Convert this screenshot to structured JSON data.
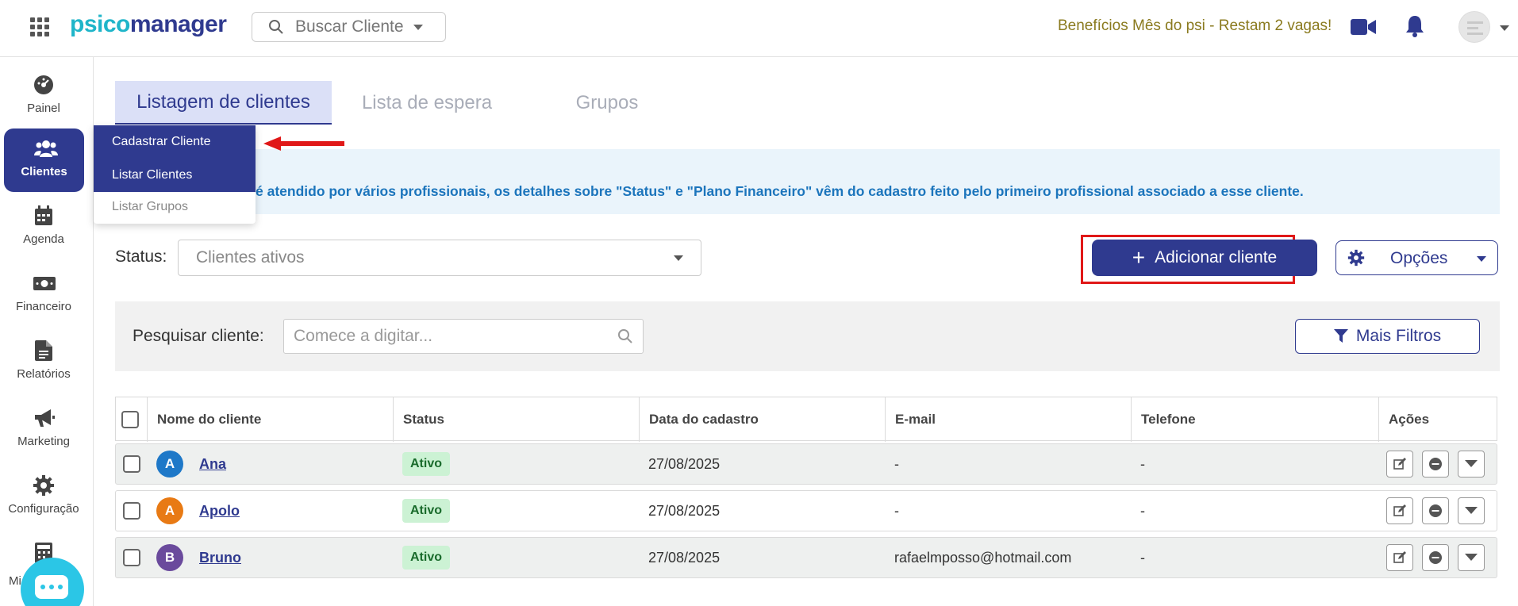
{
  "header": {
    "logo_part1": "psico",
    "logo_part2": "manager",
    "search_placeholder": "Buscar Cliente",
    "promo_text": "Benefícios Mês do psi - Restam 2 vagas!"
  },
  "sidebar": {
    "items": [
      {
        "label": "Painel",
        "icon": "dashboard-icon"
      },
      {
        "label": "Clientes",
        "icon": "users-icon",
        "active": true
      },
      {
        "label": "Agenda",
        "icon": "calendar-icon"
      },
      {
        "label": "Financeiro",
        "icon": "money-icon"
      },
      {
        "label": "Relatórios",
        "icon": "report-icon"
      },
      {
        "label": "Marketing",
        "icon": "megaphone-icon"
      },
      {
        "label": "Configuração",
        "icon": "gear-icon"
      },
      {
        "label": "Mi",
        "icon": "calculator-icon"
      }
    ]
  },
  "tabs": [
    {
      "label": "Listagem de clientes",
      "active": true
    },
    {
      "label": "Lista de espera"
    },
    {
      "label": "Grupos"
    }
  ],
  "clients_menu": {
    "items": [
      "Cadastrar Cliente",
      "Listar Clientes",
      "Listar Grupos"
    ]
  },
  "info_banner": {
    "text": "é atendido por vários profissionais, os detalhes sobre \"Status\" e \"Plano Financeiro\" vêm do cadastro feito pelo primeiro profissional associado a esse cliente."
  },
  "status_filter": {
    "label": "Status:",
    "value": "Clientes ativos"
  },
  "buttons": {
    "add_client": "Adicionar cliente",
    "options": "Opções",
    "more_filters": "Mais Filtros"
  },
  "search_client": {
    "label": "Pesquisar cliente:",
    "placeholder": "Comece a digitar..."
  },
  "table": {
    "columns": [
      "Nome do cliente",
      "Status",
      "Data do cadastro",
      "E-mail",
      "Telefone",
      "Ações"
    ],
    "rows": [
      {
        "initial": "A",
        "avatar_color": "#1e78c8",
        "name": "Ana",
        "status": "Ativo",
        "date": "27/08/2025",
        "email": "-",
        "phone": "-"
      },
      {
        "initial": "A",
        "avatar_color": "#e87a14",
        "name": "Apolo",
        "status": "Ativo",
        "date": "27/08/2025",
        "email": "-",
        "phone": "-"
      },
      {
        "initial": "B",
        "avatar_color": "#6a4a9c",
        "name": "Bruno",
        "status": "Ativo",
        "date": "27/08/2025",
        "email": "rafaelmposso@hotmail.com",
        "phone": "-"
      }
    ]
  },
  "colors": {
    "primary": "#2f3a8f",
    "logo_accent": "#1fb5c9",
    "promo": "#8a7a1e",
    "info_text": "#1c75bc",
    "highlight_outline": "#e01818",
    "badge_bg": "#ccf2d4"
  }
}
